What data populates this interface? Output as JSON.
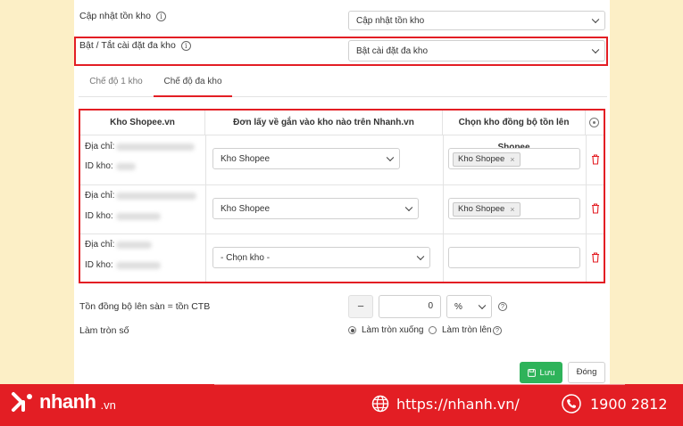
{
  "settings": {
    "stock_update_label": "Cập nhật tồn kho",
    "stock_update_value": "Cập nhật tồn kho",
    "multi_warehouse_label": "Bật / Tắt cài đặt đa kho",
    "multi_warehouse_value": "Bật cài đặt đa kho"
  },
  "tabs": [
    {
      "label": "Chế độ 1 kho",
      "active": false
    },
    {
      "label": "Chế độ đa kho",
      "active": true
    }
  ],
  "table": {
    "headers": [
      "Kho Shopee.vn",
      "Đơn lấy về gắn vào kho nào trên Nhanh.vn",
      "Chọn kho đồng bộ tồn lên Shopee"
    ],
    "address_label": "Địa chỉ:",
    "id_label": "ID kho:",
    "rows": [
      {
        "warehouse": "Kho Shopee",
        "sync_tag": "Kho Shopee"
      },
      {
        "warehouse": "Kho Shopee",
        "sync_tag": "Kho Shopee"
      },
      {
        "warehouse": "- Chọn kho -",
        "sync_tag": ""
      }
    ]
  },
  "sync": {
    "label": "Tồn đồng bộ lên sàn = tồn CTB",
    "minus": "−",
    "value": "0",
    "unit": "%"
  },
  "rounding": {
    "label": "Làm tròn số",
    "options": [
      {
        "label": "Làm tròn xuống",
        "selected": true
      },
      {
        "label": "Làm tròn lên",
        "selected": false
      }
    ]
  },
  "buttons": {
    "save": "Lưu",
    "close": "Đóng"
  },
  "footer": {
    "brand": "nhanh",
    "brand_suffix": ".vn",
    "url": "https://nhanh.vn/",
    "phone": "1900 2812"
  },
  "colors": {
    "accent": "#e31e24",
    "save": "#2eb35a",
    "background": "#fcefc6"
  }
}
